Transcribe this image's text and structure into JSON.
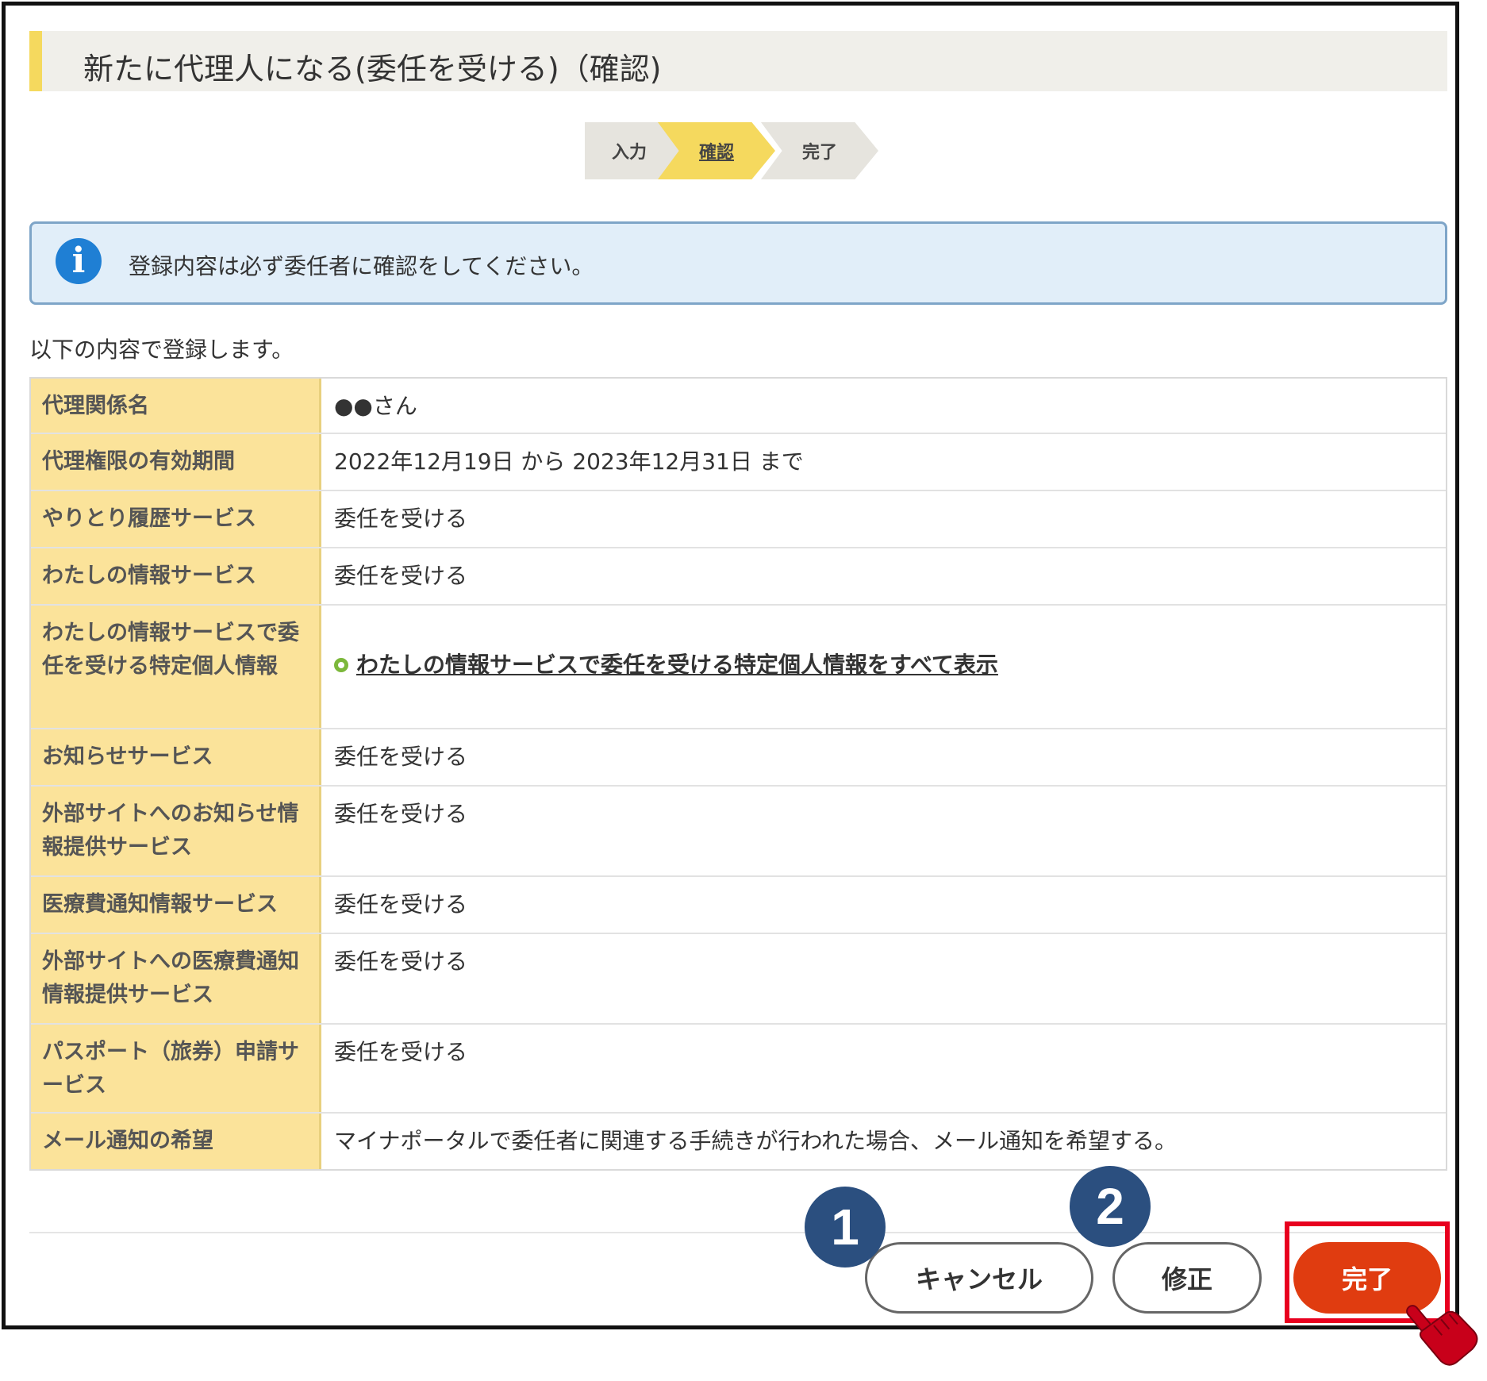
{
  "page": {
    "title": "新たに代理人になる(委任を受ける)（確認)",
    "steps": [
      "入力",
      "確認",
      "完了"
    ],
    "active_step": "確認",
    "info_message": "登録内容は必ず委任者に確認をしてください。",
    "lead_text": "以下の内容で登録します。"
  },
  "table": {
    "rows": [
      {
        "label": "代理関係名",
        "value": "●●さん"
      },
      {
        "label": "代理権限の有効期間",
        "value": "2022年12月19日 から 2023年12月31日 まで"
      },
      {
        "label": "やりとり履歴サービス",
        "value": "委任を受ける"
      },
      {
        "label": "わたしの情報サービス",
        "value": "委任を受ける"
      },
      {
        "label": "わたしの情報サービスで委任を受ける特定個人情報",
        "link": "わたしの情報サービスで委任を受ける特定個人情報をすべて表示"
      },
      {
        "label": "お知らせサービス",
        "value": "委任を受ける"
      },
      {
        "label": "外部サイトへのお知らせ情報提供サービス",
        "value": "委任を受ける"
      },
      {
        "label": "医療費通知情報サービス",
        "value": "委任を受ける"
      },
      {
        "label": "外部サイトへの医療費通知情報提供サービス",
        "value": "委任を受ける"
      },
      {
        "label": "パスポート（旅券）申請サービス",
        "value": "委任を受ける"
      },
      {
        "label": "メール通知の希望",
        "value": "マイナポータルで委任者に関連する手続きが行われた場合、メール通知を希望する。"
      }
    ]
  },
  "buttons": {
    "cancel": "キャンセル",
    "edit": "修正",
    "done": "完了"
  },
  "annotations": {
    "badge_1": "1",
    "badge_2": "2"
  },
  "colors": {
    "accent_yellow": "#f5d95e",
    "label_bg": "#fbe39a",
    "info_bg": "#e1eef9",
    "done_button": "#e03c10",
    "highlight": "#e8001f",
    "badge": "#2b4f7f"
  },
  "icons": {
    "info": "info-icon",
    "link_bullet": "circle-bullet-icon",
    "pointer": "pointing-hand-icon"
  }
}
